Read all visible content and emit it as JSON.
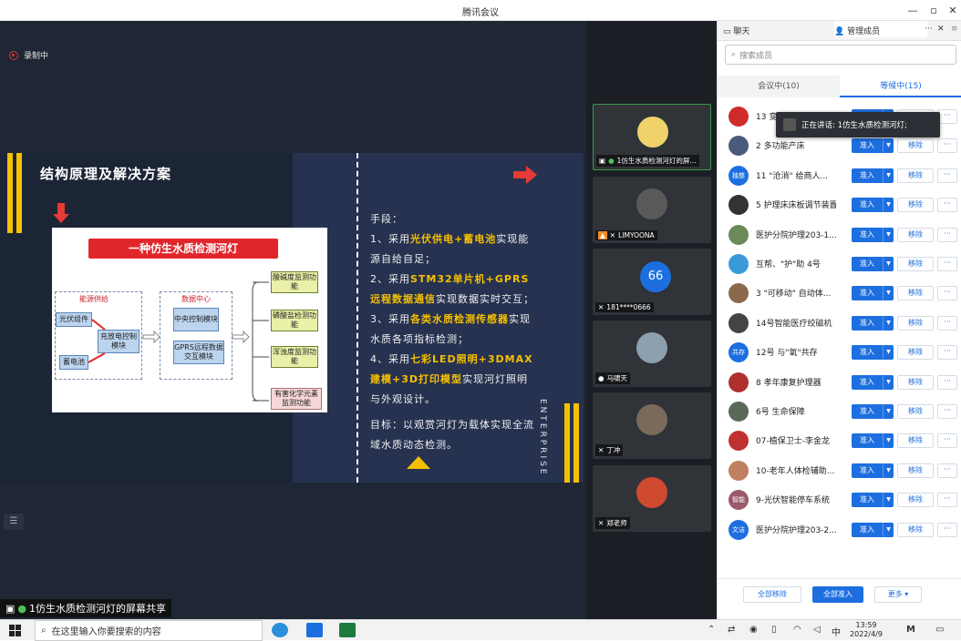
{
  "window": {
    "title": "腾讯会议"
  },
  "recording": {
    "label": "录制中"
  },
  "slide": {
    "title": "结构原理及解决方案",
    "diagram": {
      "title": "一种仿生水质检测河灯",
      "group_power": "能源供给",
      "group_data": "数据中心",
      "pv": "光伏组件",
      "battery": "蓄电池",
      "charge": "充放电控制模块",
      "central": "中央控制模块",
      "gprs": "GPRS远程数据交互模块",
      "ph": "酸碱度监测功能",
      "phosphate": "磷酸盐检测功能",
      "turbidity": "浑浊度监测功能",
      "harmful": "有害化学元素监测功能"
    },
    "text": {
      "line0": "手段：",
      "l1a": "1、采用",
      "l1h": "光伏供电+蓄电池",
      "l1b": "实现能源自给自足；",
      "l2a": "2、采用",
      "l2h": "STM32单片机+GPRS远程数据通信",
      "l2b": "实现数据实时交互；",
      "l3a": "3、采用",
      "l3h": "各类水质检测传感器",
      "l3b": "实现水质各项指标检测；",
      "l4a": "4、采用",
      "l4h": "七彩LED照明+3DMAX建模+3D打印模型",
      "l4b": "实现河灯照明与外观设计。",
      "goal": "目标：以观赏河灯为载体实现全流域水质动态检测。"
    },
    "enterprise": "ENTERPRISE"
  },
  "share_label": "1仿生水质检测河灯的屏幕共享",
  "video_tiles": [
    {
      "name": "1仿生水质检测河灯的屏..."
    },
    {
      "name": "LIMYOONA"
    },
    {
      "name": "181****0666",
      "initials": "66"
    },
    {
      "name": "马啸天"
    },
    {
      "name": "丁冲"
    },
    {
      "name": "郑老师"
    }
  ],
  "panel": {
    "tab_chat": "聊天",
    "tab_members": "管理成员",
    "more_icon_label": "···",
    "search_placeholder": "搜索成员",
    "in_meeting": "会议中(10)",
    "waiting": "等候中(15)",
    "admit_label": "准入",
    "remove_label": "移除",
    "more_label": "···",
    "members": [
      {
        "name": "13 变形工",
        "avatar": "",
        "color": "#d02a2a"
      },
      {
        "name": "2 多功能产床",
        "avatar": "",
        "color": "#4a5a7a"
      },
      {
        "name": "11 \"沧消\" 给商人...",
        "avatar": "独慈",
        "color": "#1d6fe0"
      },
      {
        "name": "5 护理床床板调节装置",
        "avatar": "",
        "color": "#333"
      },
      {
        "name": "医护分院护理203-1...",
        "avatar": "",
        "color": "#6a8a5a"
      },
      {
        "name": "互帮、\"护\"助 4号",
        "avatar": "",
        "color": "#3a9ad9"
      },
      {
        "name": "3 \"可移动\" 自动体...",
        "avatar": "",
        "color": "#8a6a4a"
      },
      {
        "name": "14号智能医疗绞磁机",
        "avatar": "",
        "color": "#444"
      },
      {
        "name": "12号 与\"氧\"共存",
        "avatar": "共存",
        "color": "#1d6fe0"
      },
      {
        "name": "8 孝年康复护理器",
        "avatar": "",
        "color": "#b03030"
      },
      {
        "name": "6号 生命保障",
        "avatar": "",
        "color": "#5a6a5a"
      },
      {
        "name": "07-植保卫士-李金龙",
        "avatar": "",
        "color": "#c03030"
      },
      {
        "name": "10-老年人体检辅助...",
        "avatar": "",
        "color": "#c08060"
      },
      {
        "name": "9-光伏智能停车系统",
        "avatar": "智能",
        "color": "#9a5a6a"
      },
      {
        "name": "医护分院护理203-2...",
        "avatar": "文洁",
        "color": "#1d6fe0"
      }
    ],
    "tooltip": "正在讲话: 1仿生水质检测河灯;",
    "btn_remove_all": "全部移除",
    "btn_admit_all": "全部准入",
    "btn_more": "更多"
  },
  "taskbar": {
    "search_placeholder": "在这里输入你要搜索的内容",
    "time": "13:59",
    "date": "2022/4/9",
    "ime": "中"
  }
}
